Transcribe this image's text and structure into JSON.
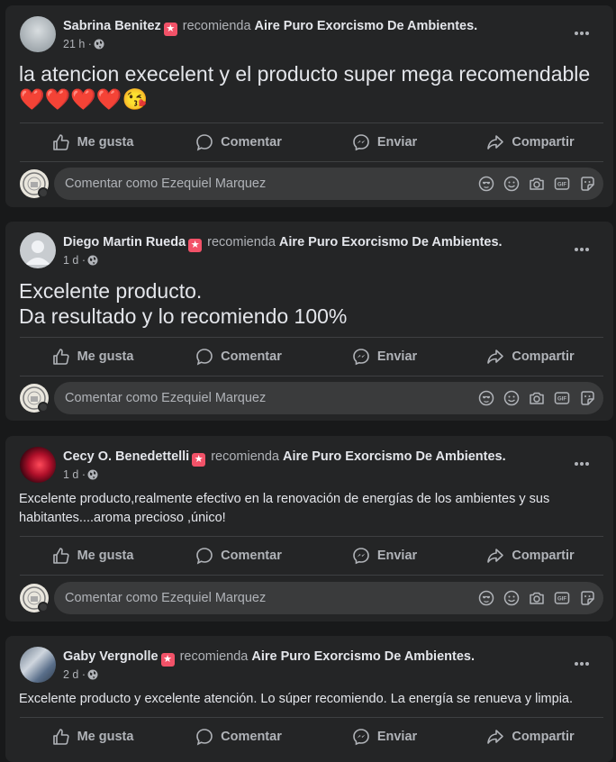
{
  "actions": {
    "like": "Me gusta",
    "comment": "Comentar",
    "send": "Enviar",
    "share": "Compartir"
  },
  "comment_placeholder": "Comentar como Ezequiel Marquez",
  "verb": "recomienda",
  "page_name": "Aire Puro Exorcismo De Ambientes.",
  "posts": [
    {
      "author": "Sabrina Benitez",
      "time": "21 h ·",
      "text": "la atencion execelent y el producto super mega recomendable ❤️❤️❤️❤️😘"
    },
    {
      "author": "Diego Martin Rueda",
      "time": "1 d ·",
      "text": "Excelente producto.\nDa resultado y lo recomiendo 100%"
    },
    {
      "author": "Cecy O. Benedettelli",
      "time": "1 d ·",
      "text": "Excelente producto,realmente efectivo en la renovación de energías de los ambientes y sus habitantes....aroma precioso ,único!"
    },
    {
      "author": "Gaby Vergnolle",
      "time": "2 d ·",
      "text": "Excelente producto y excelente atención. Lo súper recomiendo. La energía se renueva y limpia."
    }
  ],
  "colors": {
    "card": "#242526",
    "background": "#18191a",
    "badge": "#f25268",
    "muted": "#b0b3b8",
    "text": "#e4e6eb"
  }
}
